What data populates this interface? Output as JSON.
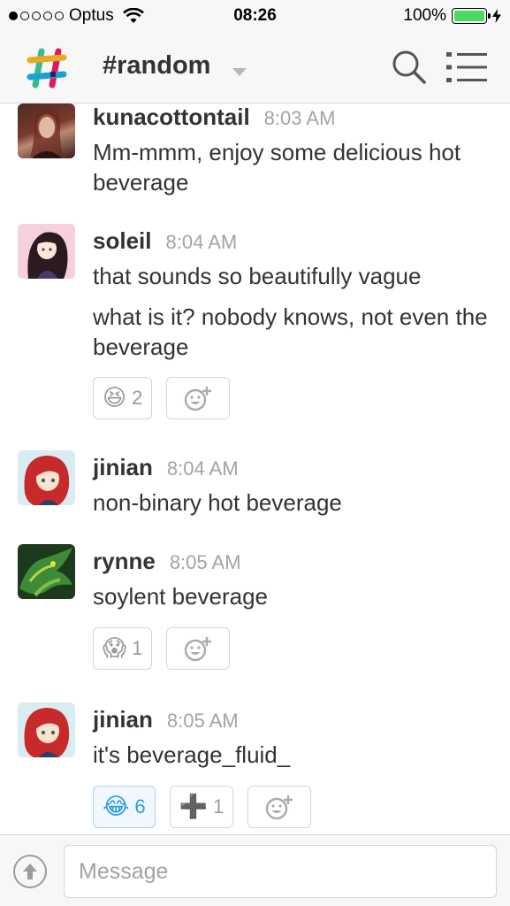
{
  "status_bar": {
    "carrier": "Optus",
    "time": "08:26",
    "battery_percent": "100%",
    "battery_level": 1.0,
    "signal_bars_filled": 1,
    "signal_bars_total": 5
  },
  "header": {
    "channel": "#random"
  },
  "messages": [
    {
      "author": "kunacottontail",
      "time": "8:03 AM",
      "lines": [
        "Mm-mmm, enjoy some delicious hot beverage"
      ],
      "reactions": []
    },
    {
      "author": "soleil",
      "time": "8:04 AM",
      "lines": [
        "that sounds so beautifully vague",
        "what is it? nobody knows, not even the beverage"
      ],
      "reactions": [
        {
          "emoji": "😆",
          "emoji_name": "laughing-emoji",
          "count": "2",
          "mine": false
        }
      ]
    },
    {
      "author": "jinian",
      "time": "8:04 AM",
      "lines": [
        "non-binary hot beverage"
      ],
      "reactions": []
    },
    {
      "author": "rynne",
      "time": "8:05 AM",
      "lines": [
        "soylent beverage"
      ],
      "reactions": [
        {
          "emoji": "😱",
          "emoji_name": "scream-emoji",
          "count": "1",
          "mine": false
        }
      ]
    },
    {
      "author": "jinian",
      "time": "8:05 AM",
      "lines": [
        "it's beverage_fluid_"
      ],
      "reactions": [
        {
          "emoji": "😂",
          "emoji_name": "joy-emoji",
          "count": "6",
          "mine": true
        },
        {
          "emoji": "➕",
          "emoji_name": "heavy-plus-emoji",
          "count": "1",
          "mine": false
        }
      ]
    }
  ],
  "composer": {
    "placeholder": "Message"
  },
  "colors": {
    "accent_blue": "#2d9de0",
    "battery_green": "#4cd964",
    "time_gray": "#a3a3a3"
  }
}
